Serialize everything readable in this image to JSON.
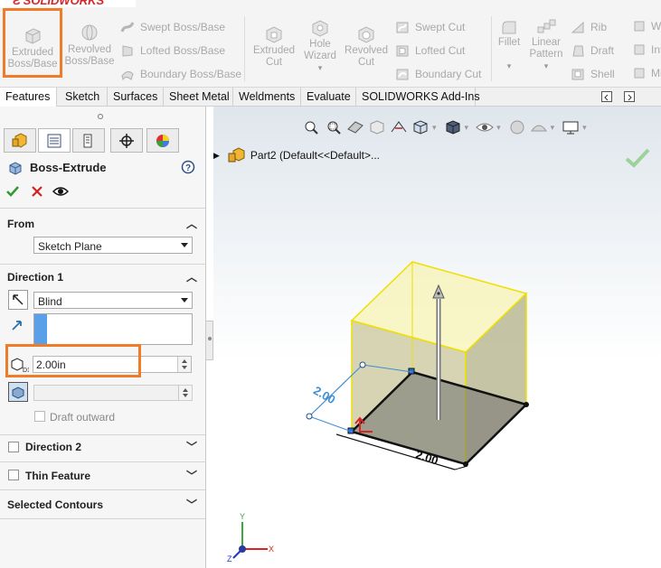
{
  "app": {
    "logo": "SOLIDWORKS"
  },
  "ribbon": {
    "extruded_boss_base": "Extruded\nBoss/Base",
    "extruded_boss_base_l1": "Extruded",
    "extruded_boss_base_l2": "Boss/Base",
    "revolved_boss_base_l1": "Revolved",
    "revolved_boss_base_l2": "Boss/Base",
    "swept_boss_base": "Swept Boss/Base",
    "lofted_boss_base": "Lofted Boss/Base",
    "boundary_boss_base": "Boundary Boss/Base",
    "extruded_cut_l1": "Extruded",
    "extruded_cut_l2": "Cut",
    "hole_wizard_l1": "Hole",
    "hole_wizard_l2": "Wizard",
    "revolved_cut_l1": "Revolved",
    "revolved_cut_l2": "Cut",
    "swept_cut": "Swept Cut",
    "lofted_cut": "Lofted Cut",
    "boundary_cut": "Boundary Cut",
    "fillet": "Fillet",
    "linear_pattern_l1": "Linear",
    "linear_pattern_l2": "Pattern",
    "rib": "Rib",
    "draft": "Draft",
    "shell": "Shell",
    "wrap_partial": "W",
    "intersect_partial": "Int",
    "mirror_partial": "Mi"
  },
  "tabs": [
    "Features",
    "Sketch",
    "Surfaces",
    "Sheet Metal",
    "Weldments",
    "Evaluate",
    "SOLIDWORKS Add-Ins"
  ],
  "property_manager": {
    "title": "Boss-Extrude",
    "from": {
      "label": "From",
      "selected": "Sketch Plane"
    },
    "direction1": {
      "label": "Direction 1",
      "end_condition": "Blind",
      "depth": "2.00in",
      "draft_outward": "Draft outward"
    },
    "direction2": {
      "label": "Direction 2"
    },
    "thin_feature": {
      "label": "Thin Feature"
    },
    "selected_contours": {
      "label": "Selected Contours"
    }
  },
  "viewport": {
    "tree_item": "Part2  (Default<<Default>...",
    "dim_horizontal": "2.00",
    "dim_vertical": "2.00",
    "triad": {
      "x": "X",
      "y": "Y",
      "z": "Z"
    }
  },
  "colors": {
    "highlight": "#f07c2a",
    "extrude_preview": "#f3f0a0",
    "edge_yellow": "#f0e000",
    "dimension_blue": "#3f8fd2"
  }
}
